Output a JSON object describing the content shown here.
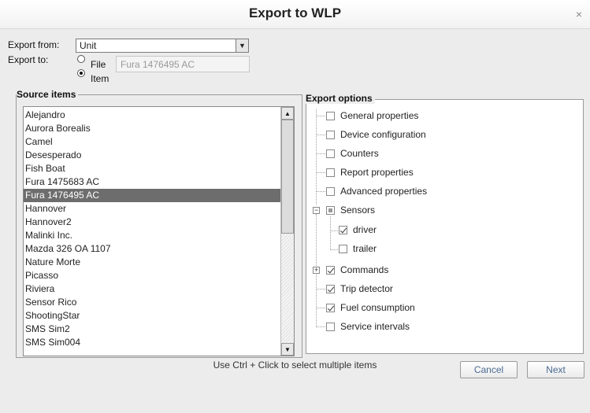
{
  "dialog": {
    "title": "Export to WLP",
    "close_glyph": "×"
  },
  "export_from": {
    "label": "Export from:",
    "value": "Unit"
  },
  "export_to": {
    "label": "Export to:",
    "file_label": "File",
    "item_label": "Item",
    "selected": "Item",
    "file_value": "Fura 1476495 AC"
  },
  "source": {
    "title": "Source items",
    "items": [
      "Alejandro",
      "Aurora Borealis",
      "Camel",
      "Desesperado",
      "Fish Boat",
      "Fura 1475683 AC",
      "Fura 1476495 AC",
      "Hannover",
      "Hannover2",
      "Malinki Inc.",
      "Mazda 326 OA 1107",
      "Nature Morte",
      "Picasso",
      "Riviera",
      "Sensor Rico",
      "ShootingStar",
      "SMS Sim2",
      "SMS Sim004"
    ],
    "selected": "Fura 1476495 AC"
  },
  "options": {
    "title": "Export options",
    "nodes": [
      {
        "label": "General properties",
        "state": "unchecked"
      },
      {
        "label": "Device configuration",
        "state": "unchecked"
      },
      {
        "label": "Counters",
        "state": "unchecked"
      },
      {
        "label": "Report properties",
        "state": "unchecked"
      },
      {
        "label": "Advanced properties",
        "state": "unchecked"
      },
      {
        "label": "Sensors",
        "state": "partial",
        "expanded": true
      },
      {
        "label": "driver",
        "state": "checked"
      },
      {
        "label": "trailer",
        "state": "unchecked"
      },
      {
        "label": "Commands",
        "state": "checked",
        "expanded": false
      },
      {
        "label": "Trip detector",
        "state": "checked"
      },
      {
        "label": "Fuel consumption",
        "state": "checked"
      },
      {
        "label": "Service intervals",
        "state": "unchecked"
      }
    ]
  },
  "hint": "Use Ctrl + Click to select multiple items",
  "buttons": {
    "cancel": "Cancel",
    "next": "Next"
  }
}
